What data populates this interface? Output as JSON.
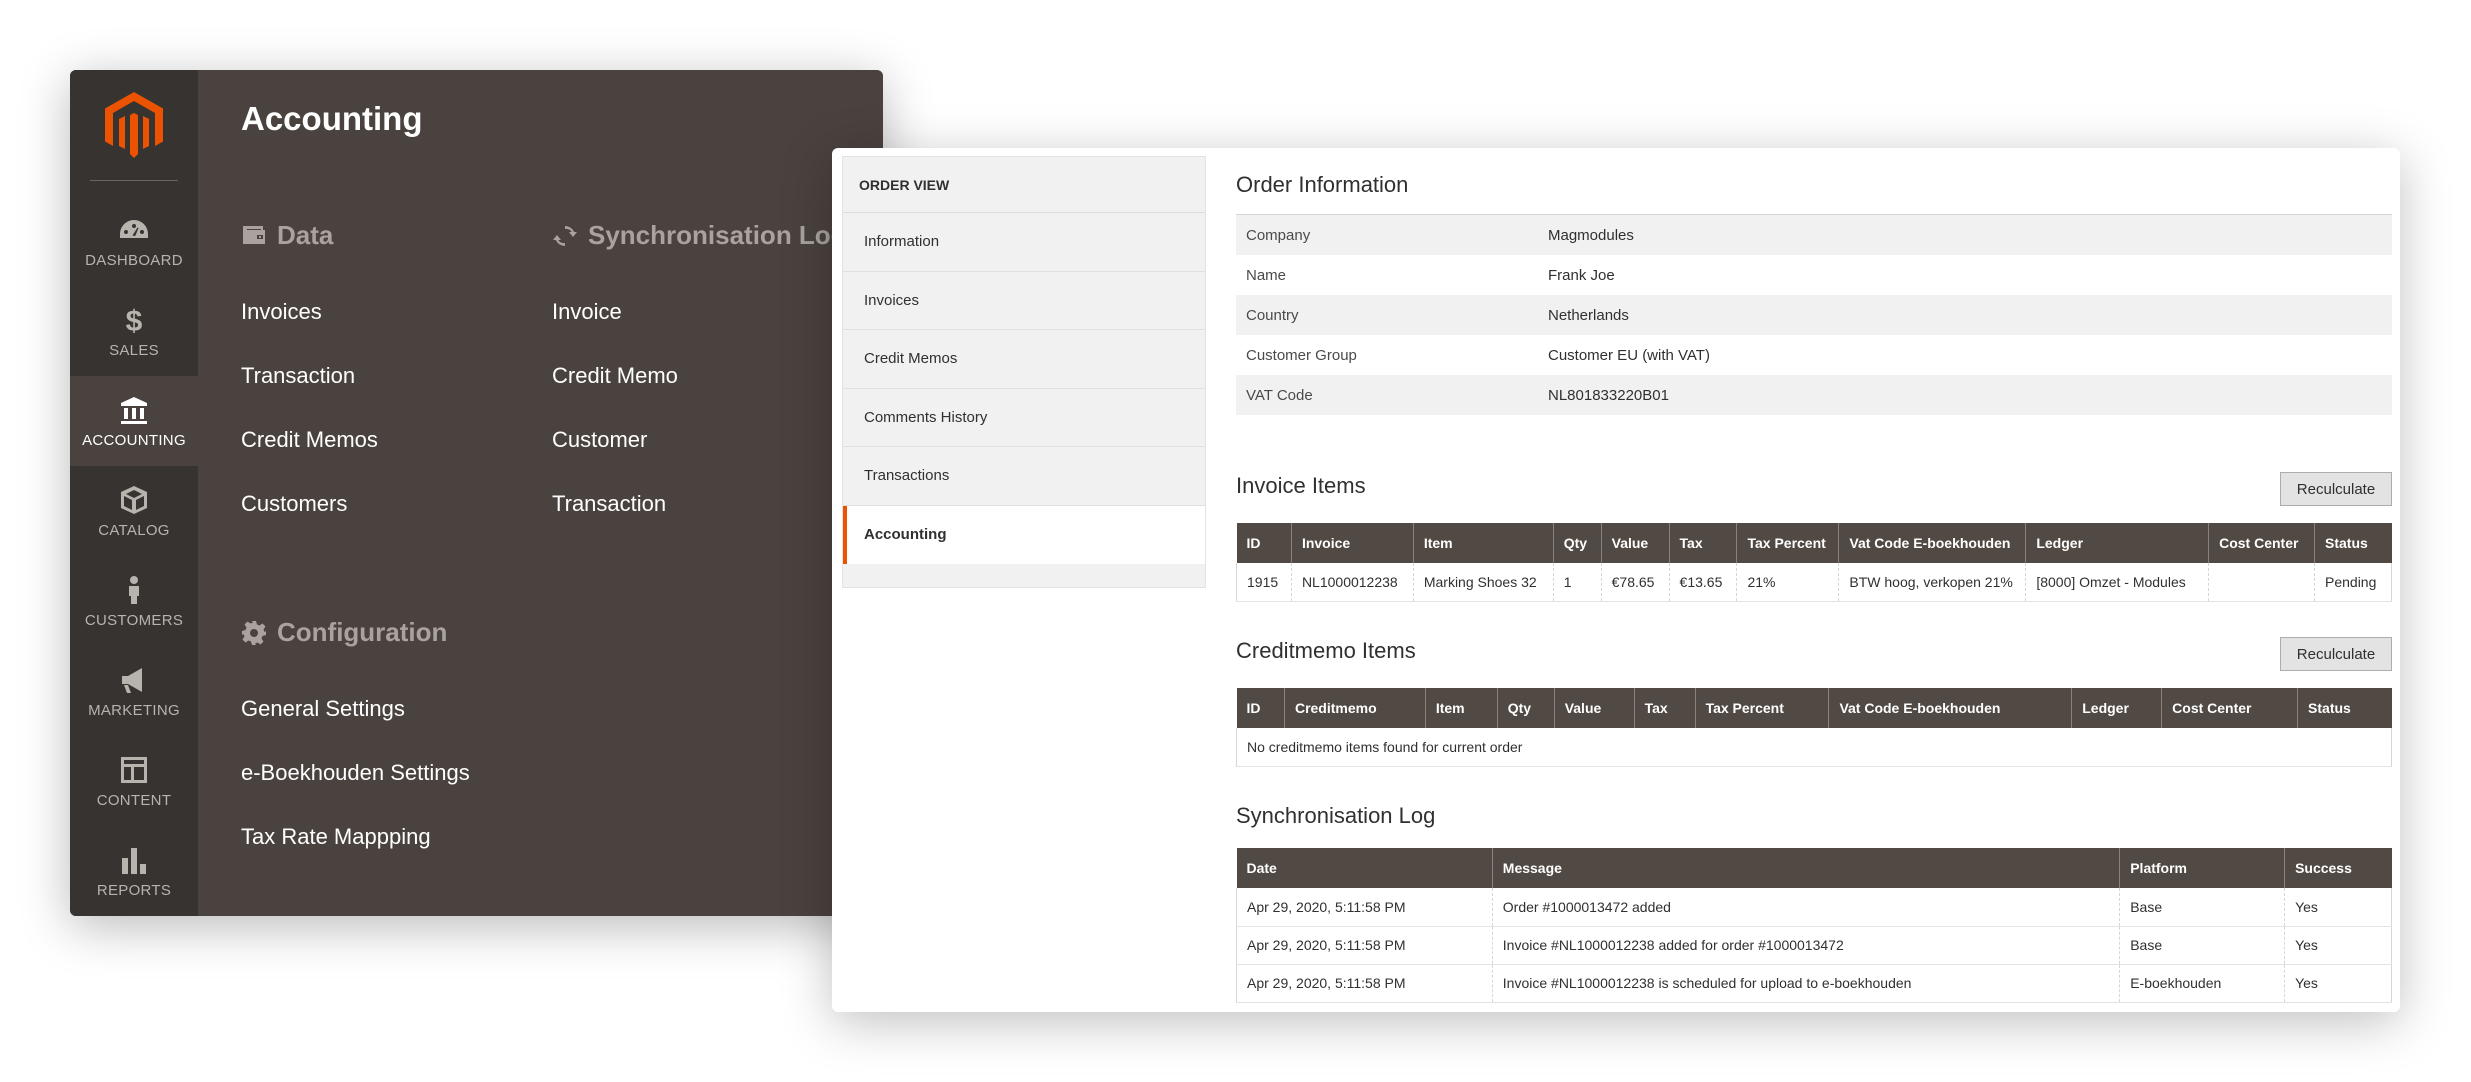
{
  "admin": {
    "nav": [
      {
        "label": "Dashboard",
        "icon": "dashboard-icon"
      },
      {
        "label": "Sales",
        "icon": "dollar-icon"
      },
      {
        "label": "Accounting",
        "icon": "bank-icon"
      },
      {
        "label": "Catalog",
        "icon": "box-icon"
      },
      {
        "label": "Customers",
        "icon": "person-icon"
      },
      {
        "label": "Marketing",
        "icon": "megaphone-icon"
      },
      {
        "label": "Content",
        "icon": "layout-icon"
      },
      {
        "label": "Reports",
        "icon": "bar-chart-icon"
      }
    ],
    "active_nav": "Accounting",
    "panel_title": "Accounting",
    "data_group": {
      "title": "Data",
      "links": [
        "Invoices",
        "Transaction",
        "Credit Memos",
        "Customers"
      ]
    },
    "sync_group": {
      "title": "Synchronisation Logs",
      "links": [
        "Invoice",
        "Credit Memo",
        "Customer",
        "Transaction"
      ]
    },
    "config_group": {
      "title": "Configuration",
      "links": [
        "General Settings",
        "e-Boekhouden Settings",
        "Tax Rate Mappping"
      ]
    }
  },
  "order_view": {
    "header": "ORDER VIEW",
    "tabs": [
      "Information",
      "Invoices",
      "Credit Memos",
      "Comments History",
      "Transactions",
      "Accounting"
    ],
    "active_tab": "Accounting",
    "order_information": {
      "title": "Order Information",
      "rows": [
        {
          "label": "Company",
          "value": "Magmodules"
        },
        {
          "label": "Name",
          "value": "Frank Joe"
        },
        {
          "label": "Country",
          "value": "Netherlands"
        },
        {
          "label": "Customer Group",
          "value": "Customer EU (with VAT)"
        },
        {
          "label": "VAT Code",
          "value": "NL801833220B01"
        }
      ]
    },
    "invoice_items": {
      "title": "Invoice Items",
      "button": "Reculculate",
      "columns": [
        "ID",
        "Invoice",
        "Item",
        "Qty",
        "Value",
        "Tax",
        "Tax Percent",
        "Vat Code E-boekhouden",
        "Ledger",
        "Cost Center",
        "Status"
      ],
      "rows": [
        [
          "1915",
          "NL1000012238",
          "Marking Shoes 32",
          "1",
          "€78.65",
          "€13.65",
          "21%",
          "BTW hoog, verkopen 21%",
          "[8000] Omzet - Modules",
          "",
          "Pending"
        ]
      ]
    },
    "creditmemo_items": {
      "title": "Creditmemo Items",
      "button": "Reculculate",
      "columns": [
        "ID",
        "Creditmemo",
        "Item",
        "Qty",
        "Value",
        "Tax",
        "Tax Percent",
        "Vat Code E-boekhouden",
        "Ledger",
        "Cost Center",
        "Status"
      ],
      "empty_message": "No creditmemo items found for current order"
    },
    "sync_log": {
      "title": "Synchronisation Log",
      "columns": [
        "Date",
        "Message",
        "Platform",
        "Success"
      ],
      "rows": [
        [
          "Apr 29, 2020, 5:11:58 PM",
          "Order #1000013472 added",
          "Base",
          "Yes"
        ],
        [
          "Apr 29, 2020, 5:11:58 PM",
          "Invoice #NL1000012238 added for order #1000013472",
          "Base",
          "Yes"
        ],
        [
          "Apr 29, 2020, 5:11:58 PM",
          "Invoice #NL1000012238 is scheduled for upload to e-boekhouden",
          "E-boekhouden",
          "Yes"
        ]
      ]
    }
  },
  "colors": {
    "accent": "#eb5202",
    "nav_bg": "#373330",
    "panel_bg": "#4a423e",
    "table_header": "#514943"
  }
}
